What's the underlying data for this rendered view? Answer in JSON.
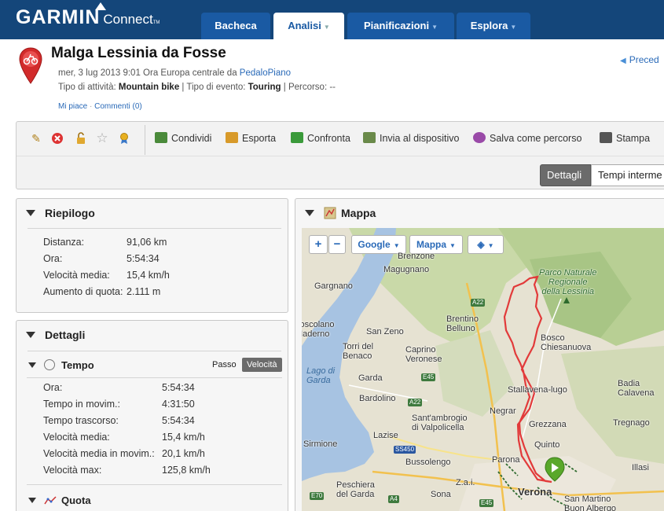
{
  "header": {
    "logo_text": "GARMIN",
    "logo_sub": "Connect",
    "tabs": [
      {
        "label": "Bacheca",
        "caret": ""
      },
      {
        "label": "Analisi",
        "caret": "▼"
      },
      {
        "label": "Pianificazioni",
        "caret": "▼"
      },
      {
        "label": "Esplora",
        "caret": "▼"
      }
    ]
  },
  "activity": {
    "title": "Malga Lessinia da Fosse",
    "date_prefix": "mer, 3 lug 2013 9:01 Ora Europa centrale da ",
    "author": "PedaloPiano",
    "type_label": "Tipo di attività: ",
    "type_value": "Mountain bike",
    "event_label": " | Tipo di evento: ",
    "event_value": "Touring",
    "route_label": " | Percorso: --",
    "like": "Mi piace",
    "separator": " · ",
    "comments": "Commenti (0)",
    "previous": "Preced"
  },
  "toolbar": {
    "icons": [
      "pencil-icon",
      "delete-icon",
      "lock-icon",
      "star-icon",
      "award-icon"
    ],
    "buttons": [
      {
        "label": "Condividi",
        "icon": "share-icon",
        "color": "#4a8a3a"
      },
      {
        "label": "Esporta",
        "icon": "export-icon",
        "color": "#d89a2a"
      },
      {
        "label": "Confronta",
        "icon": "compare-icon",
        "color": "#3a9a3a"
      },
      {
        "label": "Invia al dispositivo",
        "icon": "device-icon",
        "color": "#6a8a4a"
      },
      {
        "label": "Salva come percorso",
        "icon": "course-icon",
        "color": "#9a4aa8"
      },
      {
        "label": "Stampa",
        "icon": "print-icon",
        "color": "#555555"
      }
    ],
    "view_details": "Dettagli",
    "view_laps": "Tempi interme"
  },
  "summary": {
    "heading": "Riepilogo",
    "rows": [
      {
        "label": "Distanza:",
        "value": "91,06 km"
      },
      {
        "label": "Ora:",
        "value": "5:54:34"
      },
      {
        "label": "Velocità media:",
        "value": "15,4 km/h"
      },
      {
        "label": "Aumento di quota:",
        "value": "2.111 m"
      }
    ]
  },
  "details": {
    "heading": "Dettagli",
    "time_heading": "Tempo",
    "toggle_pace": "Passo",
    "toggle_speed": "Velocità",
    "rows": [
      {
        "label": "Ora:",
        "value": "5:54:34"
      },
      {
        "label": "Tempo in movim.:",
        "value": "4:31:50"
      },
      {
        "label": "Tempo trascorso:",
        "value": "5:54:34"
      },
      {
        "label": "Velocità media:",
        "value": "15,4 km/h"
      },
      {
        "label": "Velocità media in movim.:",
        "value": "20,1 km/h"
      },
      {
        "label": "Velocità max:",
        "value": "125,8 km/h"
      }
    ],
    "elevation_heading": "Quota"
  },
  "map_panel": {
    "heading": "Mappa",
    "zoom_in": "+",
    "zoom_out": "−",
    "provider": "Google",
    "map_type": "Mappa",
    "layers_icon": "layers-icon",
    "places": [
      "Brenzone",
      "Magugnano",
      "Gargnano",
      "Toscolano\nMaderno",
      "San Zeno",
      "Torri del\nBenaco",
      "Caprino\nVeronese",
      "Brentino\nBelluno",
      "Garda",
      "Lago di\nGarda",
      "Bardolino",
      "Sant'ambrogio\ndi Valpolicella",
      "Lazise",
      "Sirmione",
      "Bussolengo",
      "Peschiera\ndel Garda",
      "Sona",
      "Z.a.i.",
      "Verona",
      "Parona",
      "Negrar",
      "Grezzana",
      "Quinto",
      "Stallavena-lugo",
      "Bosco\nChiesanuova",
      "Parco Naturale\nRegionale\ndella Lessinia",
      "Badia\nCalavena",
      "Tregnago",
      "Illasi",
      "San Martino\nBuon Albergo"
    ],
    "roads": [
      "A22",
      "E45",
      "A22",
      "SS450",
      "E70",
      "A4",
      "E45"
    ]
  },
  "colors": {
    "header_bg": "#14467a",
    "tab_bg": "#1a5aa3",
    "link": "#2a6ab8",
    "route": "#e23a3a",
    "start_marker": "#5aa82a"
  }
}
